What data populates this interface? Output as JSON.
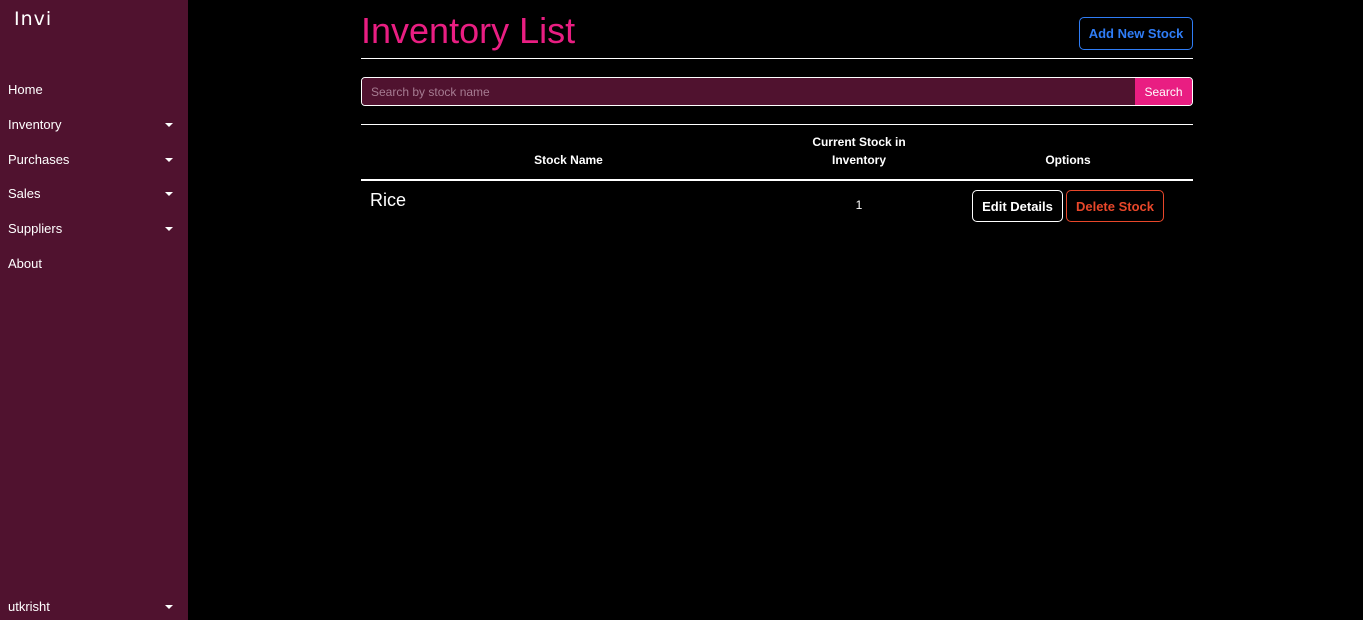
{
  "app": {
    "logo": "Invi"
  },
  "sidebar": {
    "items": [
      {
        "label": "Home",
        "dropdown": false
      },
      {
        "label": "Inventory",
        "dropdown": true
      },
      {
        "label": "Purchases",
        "dropdown": true
      },
      {
        "label": "Sales",
        "dropdown": true
      },
      {
        "label": "Suppliers",
        "dropdown": true
      },
      {
        "label": "About",
        "dropdown": false
      }
    ],
    "user": "utkrisht"
  },
  "main": {
    "title": "Inventory List",
    "add_button": "Add New Stock",
    "search": {
      "placeholder": "Search by stock name",
      "value": "",
      "button": "Search"
    },
    "table": {
      "headers": {
        "name": "Stock Name",
        "stock": "Current Stock in Inventory",
        "options": "Options"
      },
      "rows": [
        {
          "name": "Rice",
          "stock": "1",
          "edit_label": "Edit Details",
          "delete_label": "Delete Stock"
        }
      ]
    }
  },
  "colors": {
    "sidebar_bg": "#50122f",
    "accent_pink": "#e91e82",
    "link_blue": "#2f7df6",
    "danger_red": "#e8472a",
    "background": "#000000"
  }
}
